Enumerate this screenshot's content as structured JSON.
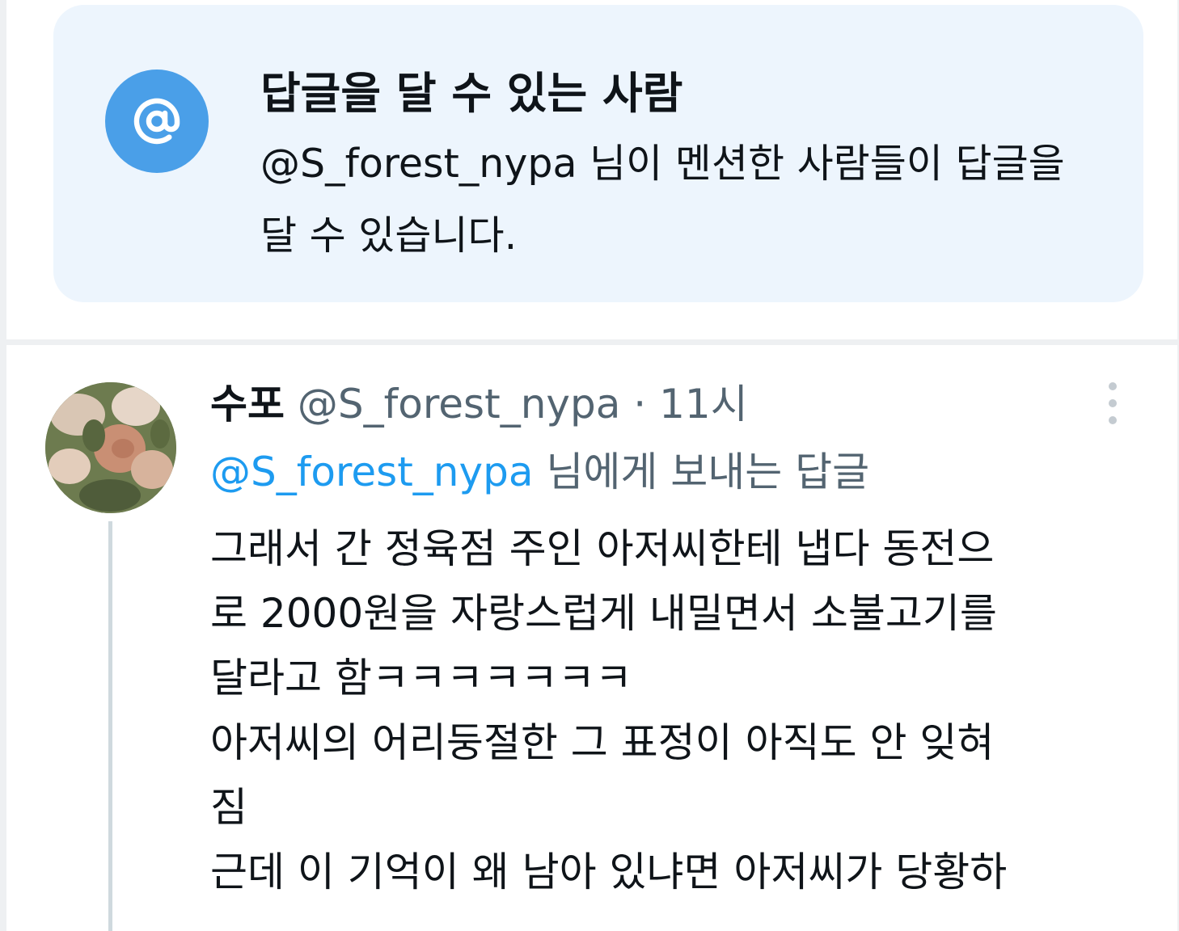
{
  "reply_settings": {
    "icon": "at-sign-icon",
    "title": "답글을 달 수 있는 사람",
    "description": "@S_forest_nypa 님이 멘션한 사람들이 답글을 달 수 있습니다."
  },
  "tweet": {
    "display_name": "수포",
    "handle": "@S_forest_nypa",
    "separator": "·",
    "timestamp": "11시",
    "reply_to_handle": "@S_forest_nypa",
    "reply_to_suffix": " 님에게 보내는 답글",
    "body_lines": [
      "그래서 간 정육점 주인 아저씨한테 냅다 동전으",
      "로 2000원을 자랑스럽게 내밀면서 소불고기를",
      "달라고 함ㅋㅋㅋㅋㅋㅋㅋ",
      "아저씨의 어리둥절한 그 표정이 아직도 안 잊혀",
      "짐",
      "근데 이 기억이 왜 남아 있냐면 아저씨가 당황하"
    ]
  },
  "colors": {
    "accent": "#1d9bf0",
    "badge": "#4a9fe8",
    "card_bg": "#edf5fd",
    "muted_text": "#536471"
  }
}
